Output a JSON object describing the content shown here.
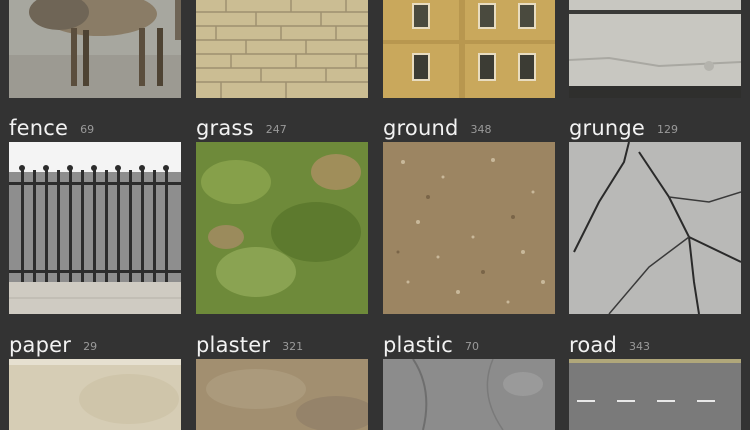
{
  "categories": [
    {
      "name": "fence",
      "count": "69"
    },
    {
      "name": "grass",
      "count": "247"
    },
    {
      "name": "ground",
      "count": "348"
    },
    {
      "name": "grunge",
      "count": "129"
    },
    {
      "name": "paper",
      "count": "29"
    },
    {
      "name": "plaster",
      "count": "321"
    },
    {
      "name": "plastic",
      "count": "70"
    },
    {
      "name": "road",
      "count": "343"
    }
  ],
  "top_row_icons": [
    "camel-photo-icon",
    "stone-wall-texture-icon",
    "building-facade-icon",
    "concrete-texture-icon"
  ],
  "colors": {
    "background": "#333333",
    "title_text": "#f2f2f2",
    "count_text": "#9a9a9a"
  }
}
